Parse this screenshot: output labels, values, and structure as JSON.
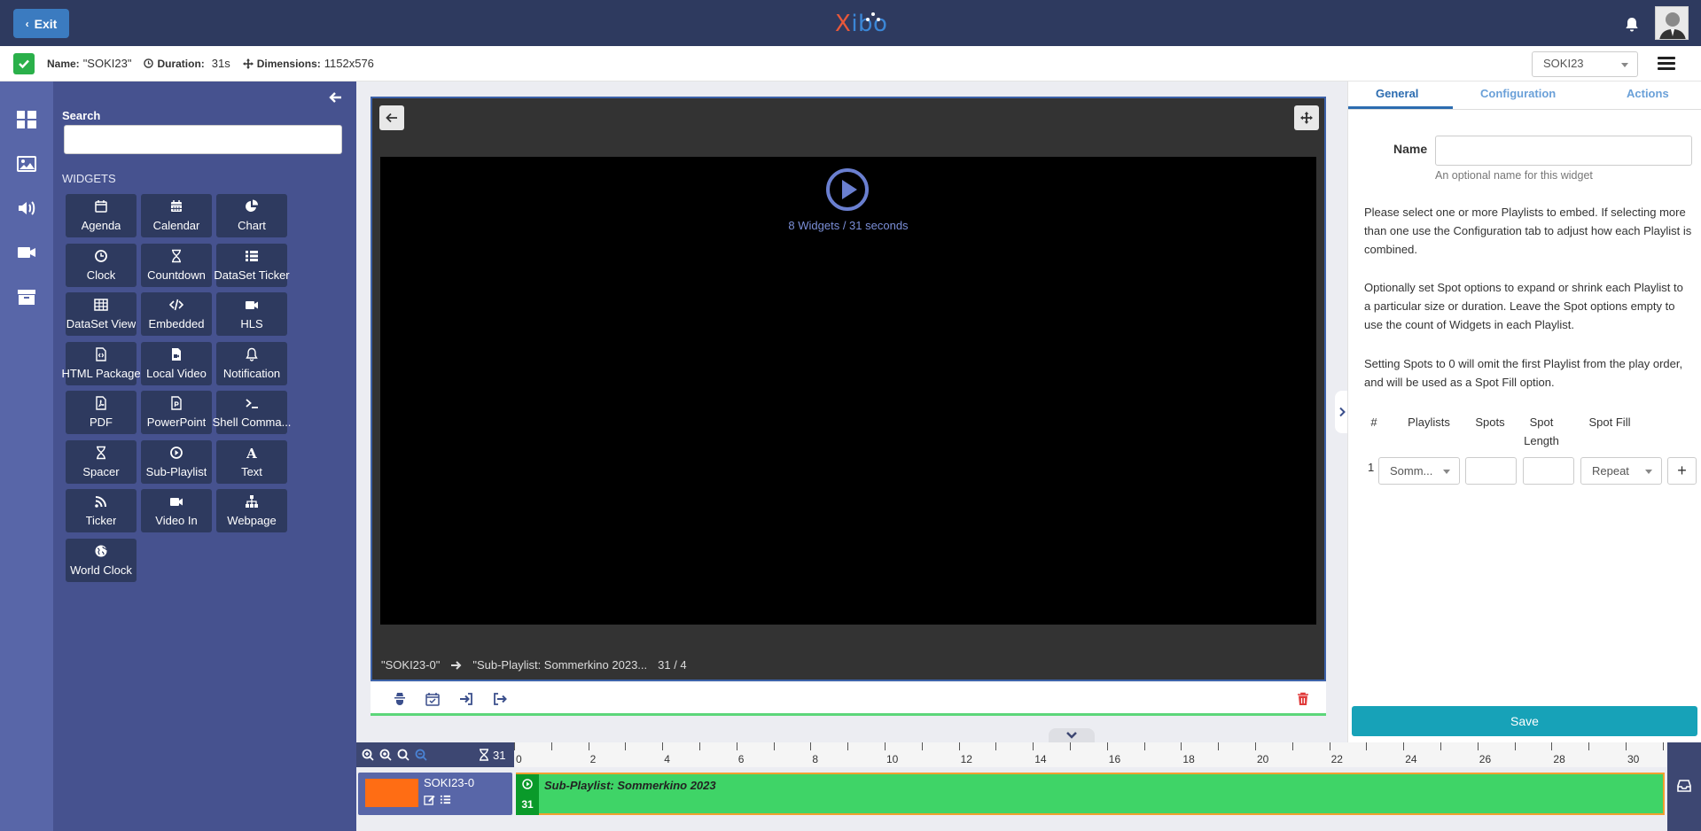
{
  "header": {
    "exit_label": "Exit",
    "logo_x": "X",
    "logo_rest": "ibo"
  },
  "infobar": {
    "name_label": "Name:",
    "name_value": "\"SOKI23\"",
    "duration_label": "Duration:",
    "duration_value": "31s",
    "dimensions_label": "Dimensions:",
    "dimensions_value": "1152x576",
    "layout_select_value": "SOKI23"
  },
  "toolbox": {
    "search_label": "Search",
    "search_placeholder": "",
    "widgets_title": "Widgets",
    "widgets": [
      {
        "label": "Agenda",
        "icon": "calendar-icon"
      },
      {
        "label": "Calendar",
        "icon": "calendar-grid-icon"
      },
      {
        "label": "Chart",
        "icon": "pie-chart-icon"
      },
      {
        "label": "Clock",
        "icon": "clock-icon"
      },
      {
        "label": "Countdown",
        "icon": "hourglass-icon"
      },
      {
        "label": "DataSet Ticker",
        "icon": "list-icon"
      },
      {
        "label": "DataSet View",
        "icon": "table-icon"
      },
      {
        "label": "Embedded",
        "icon": "code-icon"
      },
      {
        "label": "HLS",
        "icon": "video-camera-icon"
      },
      {
        "label": "HTML Package",
        "icon": "file-code-icon"
      },
      {
        "label": "Local Video",
        "icon": "file-video-icon"
      },
      {
        "label": "Notification",
        "icon": "bell-icon"
      },
      {
        "label": "PDF",
        "icon": "file-pdf-icon"
      },
      {
        "label": "PowerPoint",
        "icon": "file-powerpoint-icon"
      },
      {
        "label": "Shell Comma...",
        "icon": "terminal-icon"
      },
      {
        "label": "Spacer",
        "icon": "hourglass-icon"
      },
      {
        "label": "Sub-Playlist",
        "icon": "play-circle-icon"
      },
      {
        "label": "Text",
        "icon": "font-icon"
      },
      {
        "label": "Ticker",
        "icon": "rss-icon"
      },
      {
        "label": "Video In",
        "icon": "video-camera-icon"
      },
      {
        "label": "Webpage",
        "icon": "sitemap-icon"
      },
      {
        "label": "World Clock",
        "icon": "globe-icon"
      }
    ]
  },
  "viewer": {
    "canvas_info": "8 Widgets / 31 seconds",
    "crumb_region": "\"SOKI23-0\"",
    "crumb_playlist": "\"Sub-Playlist: Sommerkino 2023...",
    "crumb_position": "31 / 4"
  },
  "properties": {
    "tabs": [
      "General",
      "Configuration",
      "Actions"
    ],
    "name_label": "Name",
    "name_value": "",
    "name_help": "An optional name for this widget",
    "para1": "Please select one or more Playlists to embed. If selecting more than one use the Configuration tab to adjust how each Playlist is combined.",
    "para2": "Optionally set Spot options to expand or shrink each Playlist to a particular size or duration. Leave the Spot options empty to use the count of Widgets in each Playlist.",
    "para3": "Setting Spots to 0 will omit the first Playlist from the play order, and will be used as a Spot Fill option.",
    "table_headers": [
      "#",
      "Playlists",
      "Spots",
      "Spot Length",
      "Spot Fill"
    ],
    "row": {
      "num": "1",
      "playlist": "Somm...",
      "spots": "",
      "spot_length": "",
      "spot_fill": "Repeat"
    },
    "plus": "+",
    "save_label": "Save"
  },
  "timeline": {
    "duration_value": "31",
    "ticks": [
      "0",
      "2",
      "4",
      "6",
      "8",
      "10",
      "12",
      "14",
      "16",
      "18",
      "20",
      "22",
      "24",
      "26",
      "28",
      "30"
    ],
    "region_name": "SOKI23-0",
    "region_color": "#ff6d14",
    "widget_name": "Sub-Playlist: Sommerkino 2023",
    "widget_duration": "31"
  },
  "colors": {
    "navbar": "#2e3a5f",
    "toolbox": "#46528f",
    "accent": "#17a2b8",
    "widget_green": "#3fd467"
  }
}
